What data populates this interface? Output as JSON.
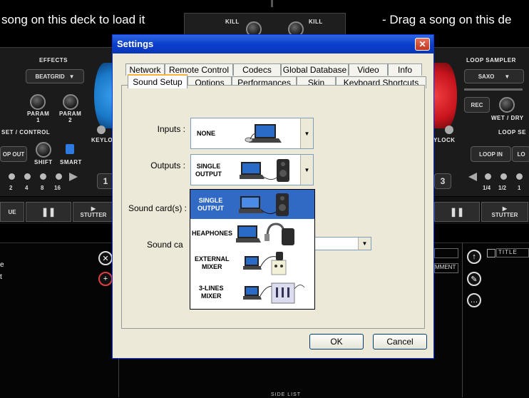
{
  "background": {
    "deck_left_msg": "song on this deck to load it",
    "deck_right_msg": "- Drag a song on this de",
    "kill_left": "KILL",
    "kill_right": "KILL",
    "effects_label": "EFFECTS",
    "effect_select": "BEATGRID",
    "param1": "PARAM\n1",
    "param2": "PARAM\n2",
    "control_label": "SET / CONTROL",
    "loop_out": "OP OUT",
    "shift": "SHIFT",
    "smart": "SMART",
    "keylock_left": "KEYLO",
    "loop_nums_left": [
      "2",
      "4",
      "8",
      "16"
    ],
    "loop_sampler_label": "LOOP SAMPLER",
    "sampler_select": "SAXO",
    "rec": "REC",
    "wet_dry": "WET / DRY",
    "keylock_right": "YLOCK",
    "loop_set_label": "LOOP SE",
    "loop_in": "LOOP IN",
    "loop_nums_right": [
      "1/4",
      "1/2",
      "1"
    ],
    "stutter": "STUTTER",
    "stutter_right": "STUTTER",
    "deck_num_left": "1",
    "deck_num_right": "3",
    "title_col": "TITLE",
    "comment_col": "MMENT",
    "side_list": "SIDE LIST"
  },
  "dialog": {
    "title": "Settings",
    "close": "✕",
    "tabs_row1": [
      "Network",
      "Remote Control",
      "Codecs",
      "Global Database",
      "Video",
      "Info"
    ],
    "tabs_row2": [
      "Sound Setup",
      "Options",
      "Performances",
      "Skin",
      "Keyboard Shortcuts"
    ],
    "active_tab": "Sound Setup",
    "inputs_label": "Inputs :",
    "inputs_value": "NONE",
    "outputs_label": "Outputs :",
    "outputs_value": "SINGLE\nOUTPUT",
    "soundcards_label": "Sound card(s) :",
    "soundcard_label2": "Sound ca",
    "dropdown_options": [
      "SINGLE\nOUTPUT",
      "HEAPHONES",
      "EXTERNAL\nMIXER",
      "3-LINES\nMIXER"
    ],
    "selected_option": "SINGLE\nOUTPUT",
    "ok": "OK",
    "cancel": "Cancel"
  },
  "colors": {
    "xp_blue": "#0a3fcc",
    "selection": "#316ac5",
    "dialog_bg": "#ece9d8",
    "deck_blue": "#1a78c8",
    "deck_red": "#c8141e"
  }
}
